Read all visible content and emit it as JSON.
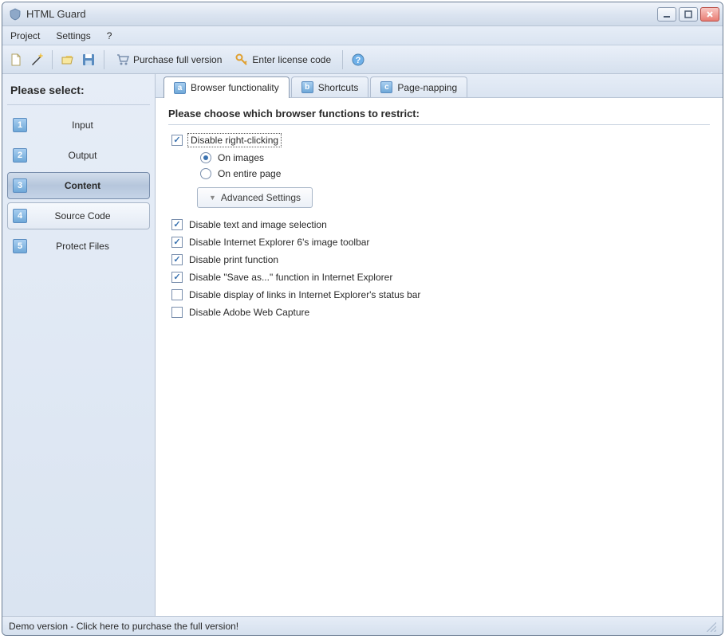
{
  "window": {
    "title": "HTML Guard"
  },
  "menu": {
    "project": "Project",
    "settings": "Settings",
    "help": "?"
  },
  "toolbar": {
    "purchase": "Purchase full version",
    "license": "Enter license code"
  },
  "sidebar": {
    "title": "Please select:",
    "items": [
      {
        "num": "1",
        "label": "Input"
      },
      {
        "num": "2",
        "label": "Output"
      },
      {
        "num": "3",
        "label": "Content"
      },
      {
        "num": "4",
        "label": "Source Code"
      },
      {
        "num": "5",
        "label": "Protect Files"
      }
    ],
    "active": 2
  },
  "tabs": [
    {
      "letter": "a",
      "label": "Browser functionality"
    },
    {
      "letter": "b",
      "label": "Shortcuts"
    },
    {
      "letter": "c",
      "label": "Page-napping"
    }
  ],
  "content": {
    "heading": "Please choose which browser functions to restrict:",
    "opt_rightclick": {
      "label": "Disable right-clicking",
      "checked": true
    },
    "radio_images": {
      "label": "On images",
      "checked": true
    },
    "radio_page": {
      "label": "On entire page",
      "checked": false
    },
    "advanced_btn": "Advanced Settings",
    "opts": [
      {
        "label": "Disable text and image selection",
        "checked": true
      },
      {
        "label": "Disable Internet Explorer 6's image toolbar",
        "checked": true
      },
      {
        "label": "Disable print function",
        "checked": true
      },
      {
        "label": "Disable \"Save as...\" function in Internet Explorer",
        "checked": true
      },
      {
        "label": "Disable display of links in Internet Explorer's status bar",
        "checked": false
      },
      {
        "label": "Disable Adobe Web Capture",
        "checked": false
      }
    ]
  },
  "status": "Demo version - Click here to purchase the full version!"
}
